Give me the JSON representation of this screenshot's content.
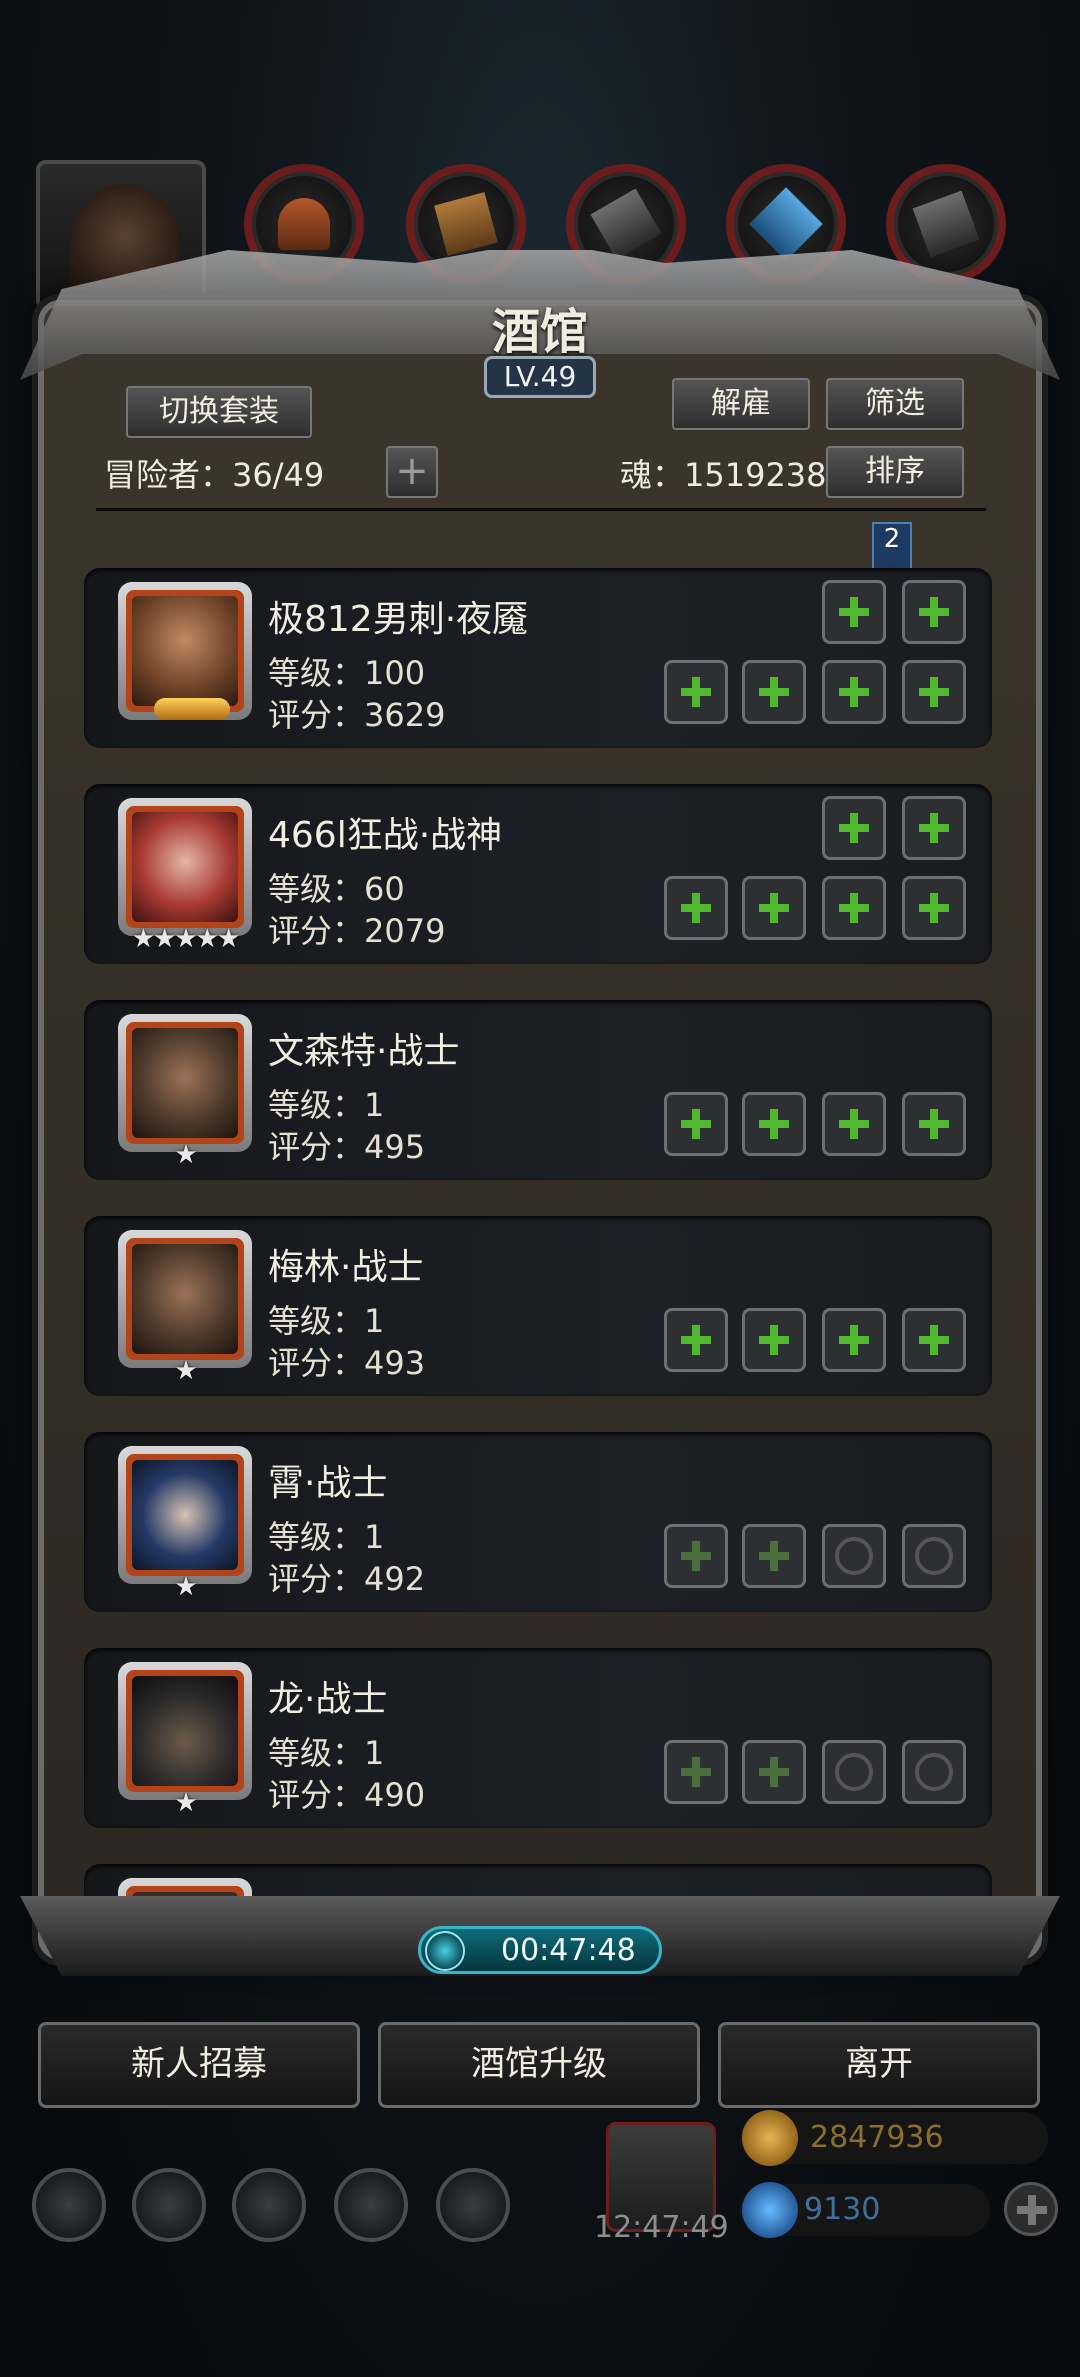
{
  "header": {
    "title": "酒馆",
    "level": "LV.49"
  },
  "toolbar": {
    "switch_outfit": "切换套装",
    "dismiss": "解雇",
    "filter": "筛选",
    "sort": "排序",
    "adventurer_label": "冒险者：36/49",
    "add_label": "+",
    "soul_label": "魂：1519238"
  },
  "bookmark": "2",
  "heroes": [
    {
      "name": "极812男刺·夜魇",
      "level": "等级：100",
      "score": "评分：3629",
      "stars": "",
      "skin": "#8a5a3c"
    },
    {
      "name": "466l狂战·战神",
      "level": "等级：60",
      "score": "评分：2079",
      "stars": "★★★★★",
      "skin": "#a83a33"
    },
    {
      "name": "文森特·战士",
      "level": "等级：1",
      "score": "评分：495",
      "stars": "★",
      "skin": "#4e3a2c"
    },
    {
      "name": "梅林·战士",
      "level": "等级：1",
      "score": "评分：493",
      "stars": "★",
      "skin": "#4e3a2c"
    },
    {
      "name": "霄·战士",
      "level": "等级：1",
      "score": "评分：492",
      "stars": "★",
      "skin": "#243a66"
    },
    {
      "name": "龙·战士",
      "level": "等级：1",
      "score": "评分：490",
      "stars": "★",
      "skin": "#2a2a2a"
    }
  ],
  "timer": "00:47:48",
  "bottom_buttons": {
    "recruit": "新人招募",
    "upgrade": "酒馆升级",
    "leave": "离开"
  },
  "status": {
    "clock": "12:47:49",
    "gold": "2847936",
    "diamond": "9130"
  },
  "colors": {
    "accent_green": "#51b82f",
    "frame_red": "#b3441a",
    "timer_cyan": "#3ab4c4"
  },
  "icons": {
    "equip_tabs": [
      "helmet-icon",
      "armor-icon",
      "gauntlet-icon",
      "crystal-icon",
      "boots-icon"
    ],
    "bottom_icons": [
      "gear-icon",
      "star-medal-icon",
      "castle-icon",
      "mail-icon",
      "shield-icon"
    ]
  }
}
